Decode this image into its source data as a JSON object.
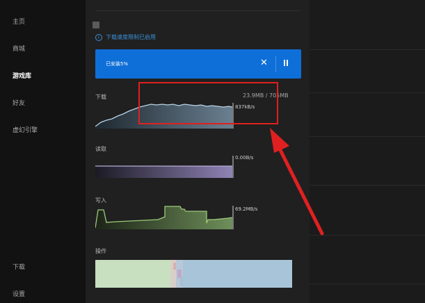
{
  "sidebar": {
    "items": [
      {
        "label": "主页"
      },
      {
        "label": "商城"
      },
      {
        "label": "游戏库",
        "active": true
      },
      {
        "label": "好友"
      },
      {
        "label": "虚幻引擎"
      }
    ],
    "bottom_items": [
      {
        "label": "下载"
      },
      {
        "label": "设置"
      }
    ]
  },
  "panel": {
    "notice_text": "下载速度限制已启用",
    "progress": {
      "label": "已安装5%",
      "fraction": 0.05,
      "close_icon": "close-icon",
      "pause_icon": "pause-icon"
    },
    "download": {
      "label": "下载",
      "size_text": "23.9MB / 705MB",
      "rate_text": "837kB/s"
    },
    "read": {
      "label": "读取",
      "rate_text": "0.00B/s"
    },
    "write": {
      "label": "写入",
      "rate_text": "69.2MB/s"
    },
    "operations": {
      "label": "操作"
    }
  },
  "colors": {
    "accent": "#0f6fd8",
    "annotation": "#e02020",
    "download_line": "#b9d4e6",
    "read_fill": "#8f83b5",
    "write_line": "#9ecb7a"
  }
}
